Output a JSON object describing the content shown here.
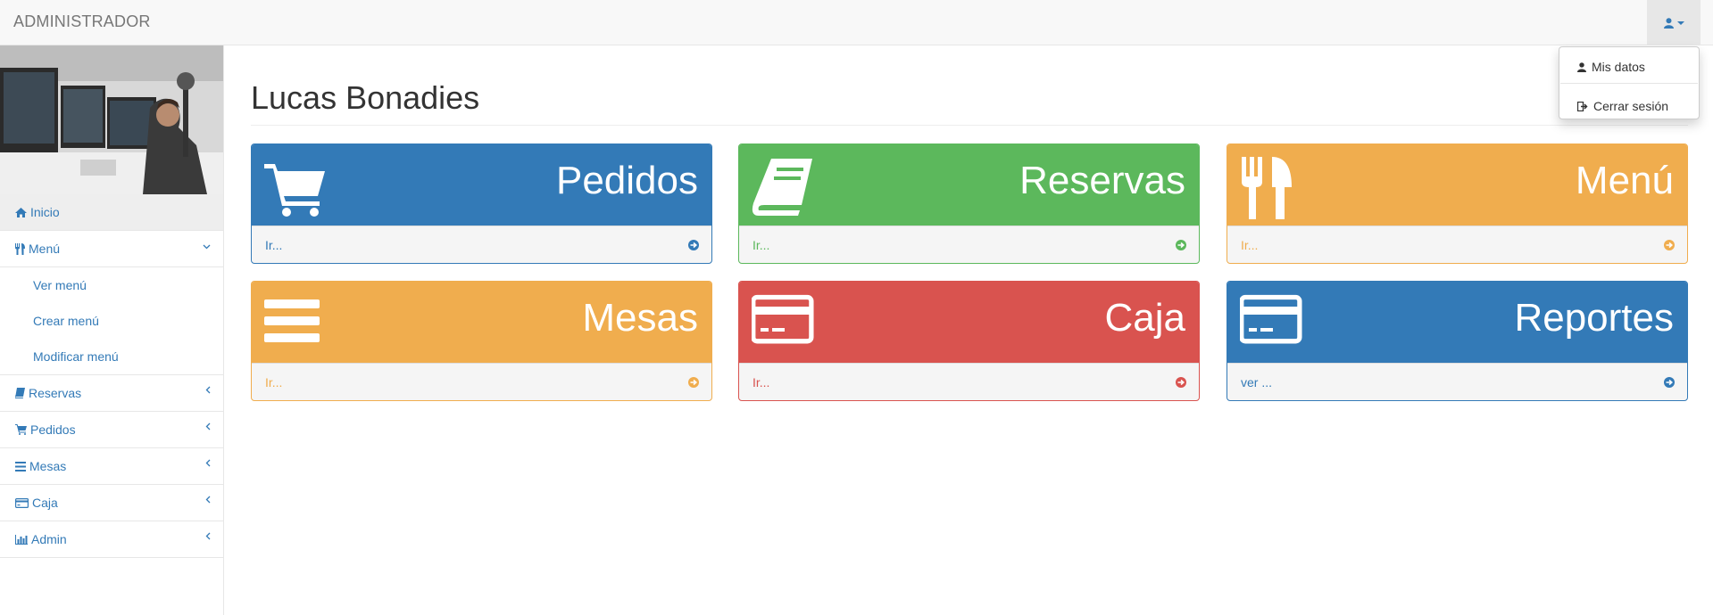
{
  "navbar": {
    "brand": "ADMINISTRADOR",
    "user_icon": "user-icon"
  },
  "user_menu": {
    "items": [
      {
        "label": "Mis datos",
        "icon": "user-icon"
      },
      {
        "label": "Cerrar sesión",
        "icon": "sign-out-icon"
      }
    ]
  },
  "sidebar": {
    "items": [
      {
        "label": "Inicio",
        "icon": "home-icon"
      },
      {
        "label": "Menú",
        "icon": "cutlery-icon"
      },
      {
        "label": "Reservas",
        "icon": "book-icon"
      },
      {
        "label": "Pedidos",
        "icon": "cart-icon"
      },
      {
        "label": "Mesas",
        "icon": "bars-icon"
      },
      {
        "label": "Caja",
        "icon": "credit-card-icon"
      },
      {
        "label": "Admin",
        "icon": "bar-chart-icon"
      }
    ],
    "submenu": [
      "Ver menú",
      "Crear menú",
      "Modificar menú"
    ]
  },
  "main": {
    "title": "Lucas Bonadies",
    "panels": [
      {
        "title": "Pedidos",
        "link": "Ir...",
        "icon": "shopping-cart-icon",
        "color": "#337ab7"
      },
      {
        "title": "Reservas",
        "link": "Ir...",
        "icon": "book-icon",
        "color": "#5cb85c"
      },
      {
        "title": "Menú",
        "link": "Ir...",
        "icon": "cutlery-icon",
        "color": "#f0ad4e"
      },
      {
        "title": "Mesas",
        "link": "Ir...",
        "icon": "bars-icon",
        "color": "#f0ad4e"
      },
      {
        "title": "Caja",
        "link": "Ir...",
        "icon": "credit-card-icon",
        "color": "#d9534f"
      },
      {
        "title": "Reportes",
        "link": "ver ...",
        "icon": "credit-card-icon",
        "color": "#337ab7"
      }
    ]
  }
}
